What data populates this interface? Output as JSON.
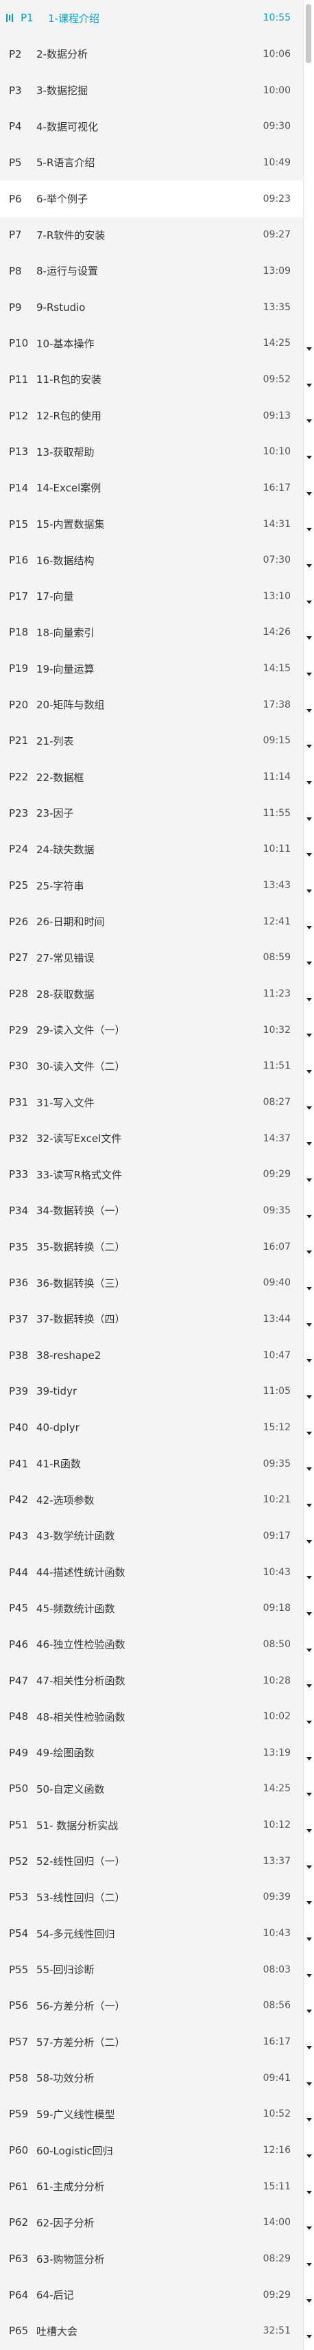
{
  "episodes": [
    {
      "pnum": "P1",
      "title": "1-课程介绍",
      "duration": "10:55",
      "active": true
    },
    {
      "pnum": "P2",
      "title": "2-数据分析",
      "duration": "10:06"
    },
    {
      "pnum": "P3",
      "title": "3-数据挖掘",
      "duration": "10:00"
    },
    {
      "pnum": "P4",
      "title": "4-数据可视化",
      "duration": "09:30"
    },
    {
      "pnum": "P5",
      "title": "5-R语言介绍",
      "duration": "10:49"
    },
    {
      "pnum": "P6",
      "title": "6-举个例子",
      "duration": "09:23",
      "selected": true
    },
    {
      "pnum": "P7",
      "title": "7-R软件的安装",
      "duration": "09:27"
    },
    {
      "pnum": "P8",
      "title": "8-运行与设置",
      "duration": "13:09"
    },
    {
      "pnum": "P9",
      "title": "9-Rstudio",
      "duration": "13:35"
    },
    {
      "pnum": "P10",
      "title": "10-基本操作",
      "duration": "14:25"
    },
    {
      "pnum": "P11",
      "title": "11-R包的安装",
      "duration": "09:52"
    },
    {
      "pnum": "P12",
      "title": "12-R包的使用",
      "duration": "09:13"
    },
    {
      "pnum": "P13",
      "title": "13-获取帮助",
      "duration": "10:10"
    },
    {
      "pnum": "P14",
      "title": "14-Excel案例",
      "duration": "16:17"
    },
    {
      "pnum": "P15",
      "title": "15-内置数据集",
      "duration": "14:31"
    },
    {
      "pnum": "P16",
      "title": "16-数据结构",
      "duration": "07:30"
    },
    {
      "pnum": "P17",
      "title": "17-向量",
      "duration": "13:10"
    },
    {
      "pnum": "P18",
      "title": "18-向量索引",
      "duration": "14:26"
    },
    {
      "pnum": "P19",
      "title": "19-向量运算",
      "duration": "14:15"
    },
    {
      "pnum": "P20",
      "title": "20-矩阵与数组",
      "duration": "17:38"
    },
    {
      "pnum": "P21",
      "title": "21-列表",
      "duration": "09:15"
    },
    {
      "pnum": "P22",
      "title": "22-数据框",
      "duration": "11:14"
    },
    {
      "pnum": "P23",
      "title": "23-因子",
      "duration": "11:55"
    },
    {
      "pnum": "P24",
      "title": "24-缺失数据",
      "duration": "10:11"
    },
    {
      "pnum": "P25",
      "title": "25-字符串",
      "duration": "13:43"
    },
    {
      "pnum": "P26",
      "title": "26-日期和时间",
      "duration": "12:41"
    },
    {
      "pnum": "P27",
      "title": "27-常见错误",
      "duration": "08:59"
    },
    {
      "pnum": "P28",
      "title": "28-获取数据",
      "duration": "11:23"
    },
    {
      "pnum": "P29",
      "title": "29-读入文件（一）",
      "duration": "10:32"
    },
    {
      "pnum": "P30",
      "title": "30-读入文件（二）",
      "duration": "11:51"
    },
    {
      "pnum": "P31",
      "title": "31-写入文件",
      "duration": "08:27"
    },
    {
      "pnum": "P32",
      "title": "32-读写Excel文件",
      "duration": "14:37"
    },
    {
      "pnum": "P33",
      "title": "33-读写R格式文件",
      "duration": "09:29"
    },
    {
      "pnum": "P34",
      "title": "34-数据转换（一）",
      "duration": "09:35"
    },
    {
      "pnum": "P35",
      "title": "35-数据转换（二）",
      "duration": "16:07"
    },
    {
      "pnum": "P36",
      "title": "36-数据转换（三）",
      "duration": "09:40"
    },
    {
      "pnum": "P37",
      "title": "37-数据转换（四）",
      "duration": "13:44"
    },
    {
      "pnum": "P38",
      "title": "38-reshape2",
      "duration": "10:47"
    },
    {
      "pnum": "P39",
      "title": "39-tidyr",
      "duration": "11:05"
    },
    {
      "pnum": "P40",
      "title": "40-dplyr",
      "duration": "15:12"
    },
    {
      "pnum": "P41",
      "title": "41-R函数",
      "duration": "09:35"
    },
    {
      "pnum": "P42",
      "title": "42-选项参数",
      "duration": "10:21"
    },
    {
      "pnum": "P43",
      "title": "43-数学统计函数",
      "duration": "09:17"
    },
    {
      "pnum": "P44",
      "title": "44-描述性统计函数",
      "duration": "10:43"
    },
    {
      "pnum": "P45",
      "title": "45-频数统计函数",
      "duration": "09:18"
    },
    {
      "pnum": "P46",
      "title": "46-独立性检验函数",
      "duration": "08:50"
    },
    {
      "pnum": "P47",
      "title": "47-相关性分析函数",
      "duration": "10:28"
    },
    {
      "pnum": "P48",
      "title": "48-相关性检验函数",
      "duration": "10:02"
    },
    {
      "pnum": "P49",
      "title": "49-绘图函数",
      "duration": "13:19"
    },
    {
      "pnum": "P50",
      "title": "50-自定义函数",
      "duration": "14:25"
    },
    {
      "pnum": "P51",
      "title": "51- 数据分析实战",
      "duration": "10:12"
    },
    {
      "pnum": "P52",
      "title": "52-线性回归（一）",
      "duration": "13:37"
    },
    {
      "pnum": "P53",
      "title": "53-线性回归（二）",
      "duration": "09:39"
    },
    {
      "pnum": "P54",
      "title": "54-多元线性回归",
      "duration": "10:43"
    },
    {
      "pnum": "P55",
      "title": "55-回归诊断",
      "duration": "08:03"
    },
    {
      "pnum": "P56",
      "title": "56-方差分析（一）",
      "duration": "08:56"
    },
    {
      "pnum": "P57",
      "title": "57-方差分析（二）",
      "duration": "16:17"
    },
    {
      "pnum": "P58",
      "title": "58-功效分析",
      "duration": "09:41"
    },
    {
      "pnum": "P59",
      "title": "59-广义线性模型",
      "duration": "10:52"
    },
    {
      "pnum": "P60",
      "title": "60-Logistic回归",
      "duration": "12:16"
    },
    {
      "pnum": "P61",
      "title": "61-主成分分析",
      "duration": "15:11"
    },
    {
      "pnum": "P62",
      "title": "62-因子分析",
      "duration": "14:00"
    },
    {
      "pnum": "P63",
      "title": "63-购物篮分析",
      "duration": "08:29"
    },
    {
      "pnum": "P64",
      "title": "64-后记",
      "duration": "09:29"
    },
    {
      "pnum": "P65",
      "title": "吐槽大会",
      "duration": "32:51"
    }
  ],
  "icons": {
    "playing": "playing-bars-icon",
    "scroll_arrow": "caret-down-icon"
  },
  "colors": {
    "accent": "#00a1d6",
    "text": "#333333",
    "background": "#f4f4f4",
    "selected_background": "#ffffff"
  }
}
